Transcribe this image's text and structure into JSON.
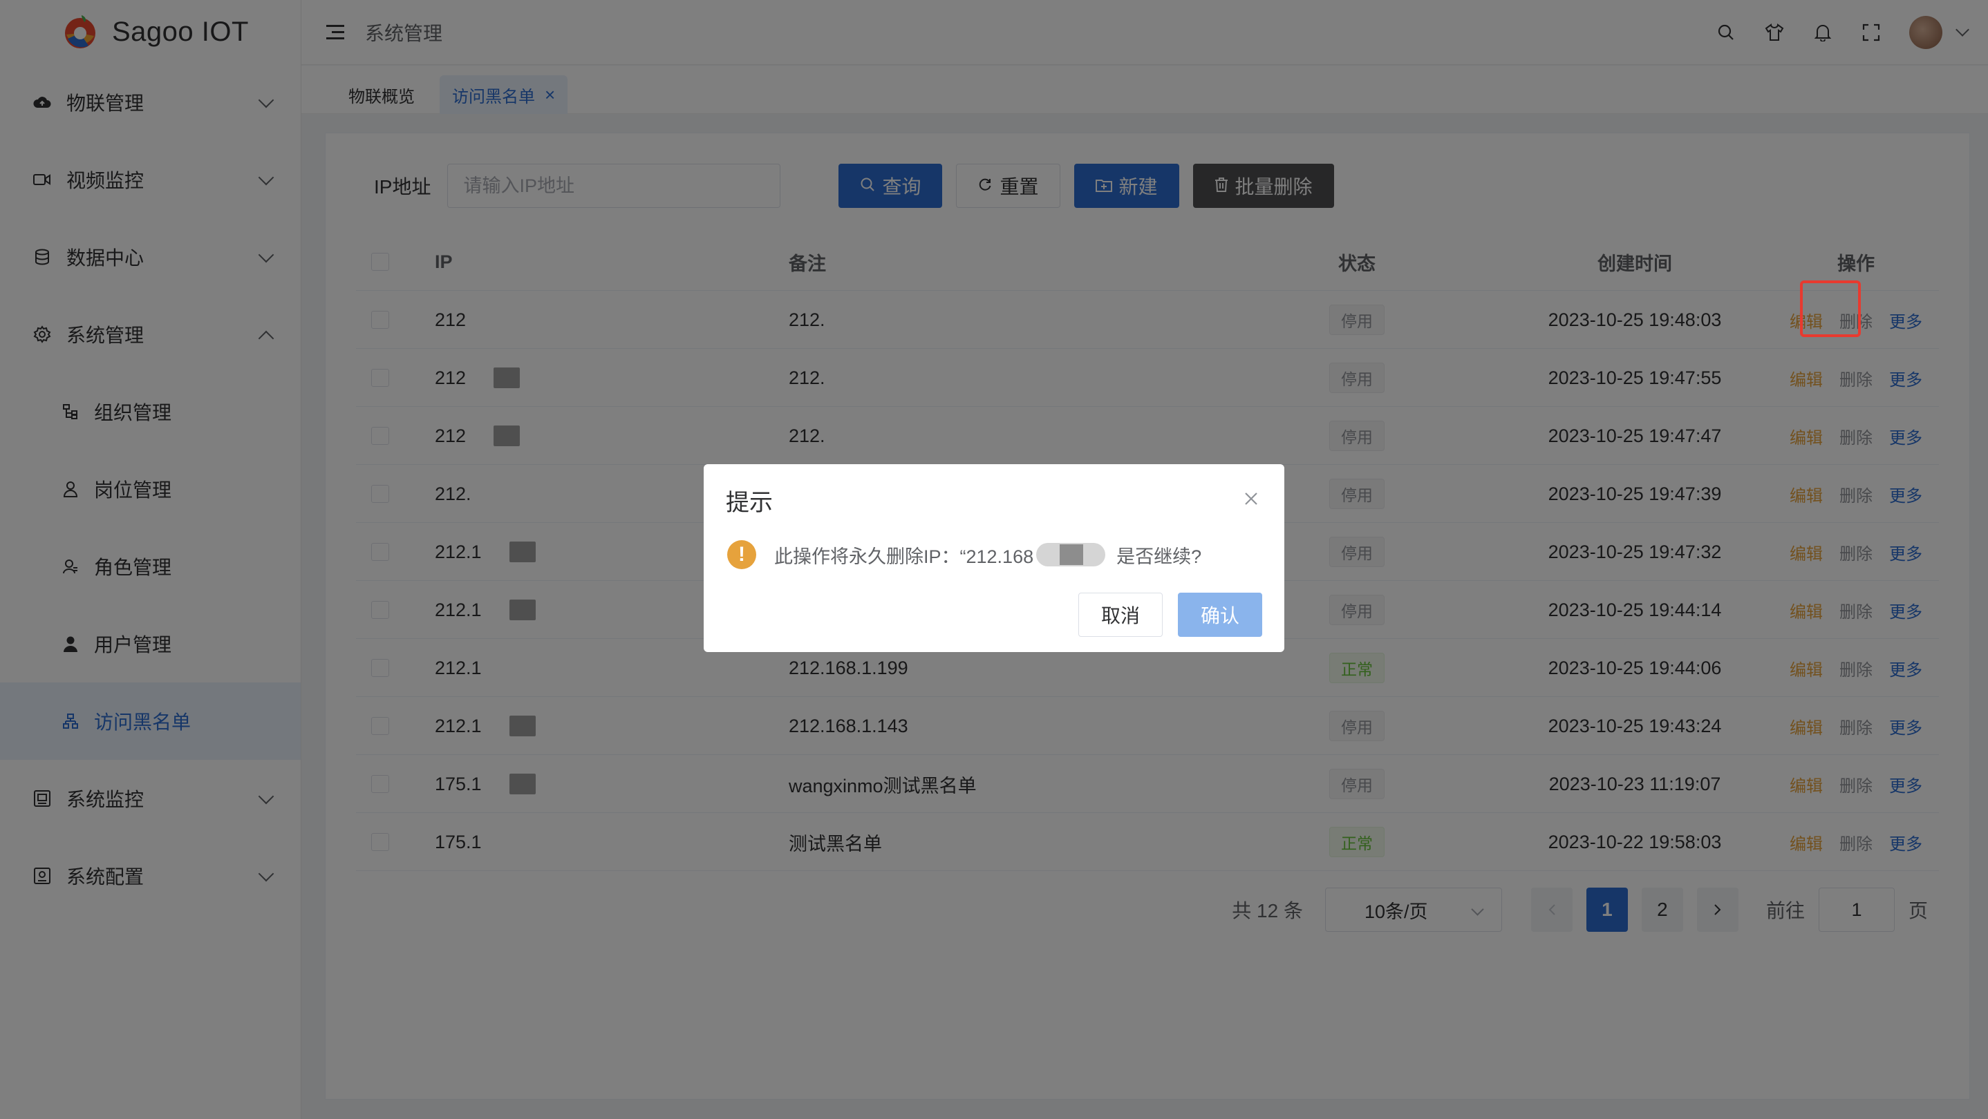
{
  "app": {
    "logo_text": "Sagoo IOT",
    "brand_color": "#2d6dd0"
  },
  "sidebar": {
    "items": [
      {
        "label": "物联管理",
        "icon": "cloud-icon"
      },
      {
        "label": "视频监控",
        "icon": "video-icon"
      },
      {
        "label": "数据中心",
        "icon": "database-icon"
      },
      {
        "label": "系统管理",
        "icon": "gear-icon",
        "expanded": true
      }
    ],
    "sub_items": [
      {
        "label": "组织管理",
        "icon": "org-icon"
      },
      {
        "label": "岗位管理",
        "icon": "person-outline-icon"
      },
      {
        "label": "角色管理",
        "icon": "role-icon"
      },
      {
        "label": "用户管理",
        "icon": "user-icon"
      },
      {
        "label": "访问黑名单",
        "icon": "blacklist-icon",
        "active": true
      }
    ],
    "bottom_items": [
      {
        "label": "系统监控",
        "icon": "monitor-icon"
      },
      {
        "label": "系统配置",
        "icon": "config-icon"
      }
    ]
  },
  "header": {
    "crumb": "系统管理"
  },
  "tabs": [
    {
      "label": "物联概览"
    },
    {
      "label": "访问黑名单",
      "active": true,
      "close": "×"
    }
  ],
  "filter": {
    "label": "IP地址",
    "placeholder": "请输入IP地址",
    "buttons": {
      "search": "查询",
      "reset": "重置",
      "create": "新建",
      "batch_delete": "批量删除"
    }
  },
  "table": {
    "columns": {
      "ip": "IP",
      "note": "备注",
      "status": "状态",
      "time": "创建时间",
      "ops": "操作"
    },
    "ops": {
      "edit": "编辑",
      "delete": "删除",
      "more": "更多"
    },
    "rows": [
      {
        "ip": "212",
        "note": "212.",
        "status": "停用",
        "time": "2023-10-25 19:48:03"
      },
      {
        "ip": "212",
        "note": "212.",
        "status": "停用",
        "time": "2023-10-25 19:47:55"
      },
      {
        "ip": "212",
        "note": "212.",
        "status": "停用",
        "time": "2023-10-25 19:47:47"
      },
      {
        "ip": "212.",
        "note": "",
        "status": "停用",
        "time": "2023-10-25 19:47:39"
      },
      {
        "ip": "212.1",
        "note": "",
        "status": "停用",
        "time": "2023-10-25 19:47:32"
      },
      {
        "ip": "212.1",
        "note": "",
        "status": "停用",
        "time": "2023-10-25 19:44:14"
      },
      {
        "ip": "212.1",
        "note": "212.168.1.199",
        "status": "正常",
        "time": "2023-10-25 19:44:06"
      },
      {
        "ip": "212.1",
        "note": "212.168.1.143",
        "status": "停用",
        "time": "2023-10-25 19:43:24"
      },
      {
        "ip": "175.1",
        "note": "wangxinmo测试黑名单",
        "status": "停用",
        "time": "2023-10-23 11:19:07"
      },
      {
        "ip": "175.1",
        "note": "测试黑名单",
        "status": "正常",
        "time": "2023-10-22 19:58:03"
      }
    ]
  },
  "pagination": {
    "total": "共 12 条",
    "page_size": "10条/页",
    "pages": [
      "1",
      "2"
    ],
    "current": "1",
    "goto_label": "前往",
    "goto_value": "1",
    "goto_suffix": "页"
  },
  "dialog": {
    "title": "提示",
    "message_prefix": "此操作将永久删除IP：“212.168",
    "message_suffix": "是否继续?",
    "cancel": "取消",
    "confirm": "确认"
  }
}
